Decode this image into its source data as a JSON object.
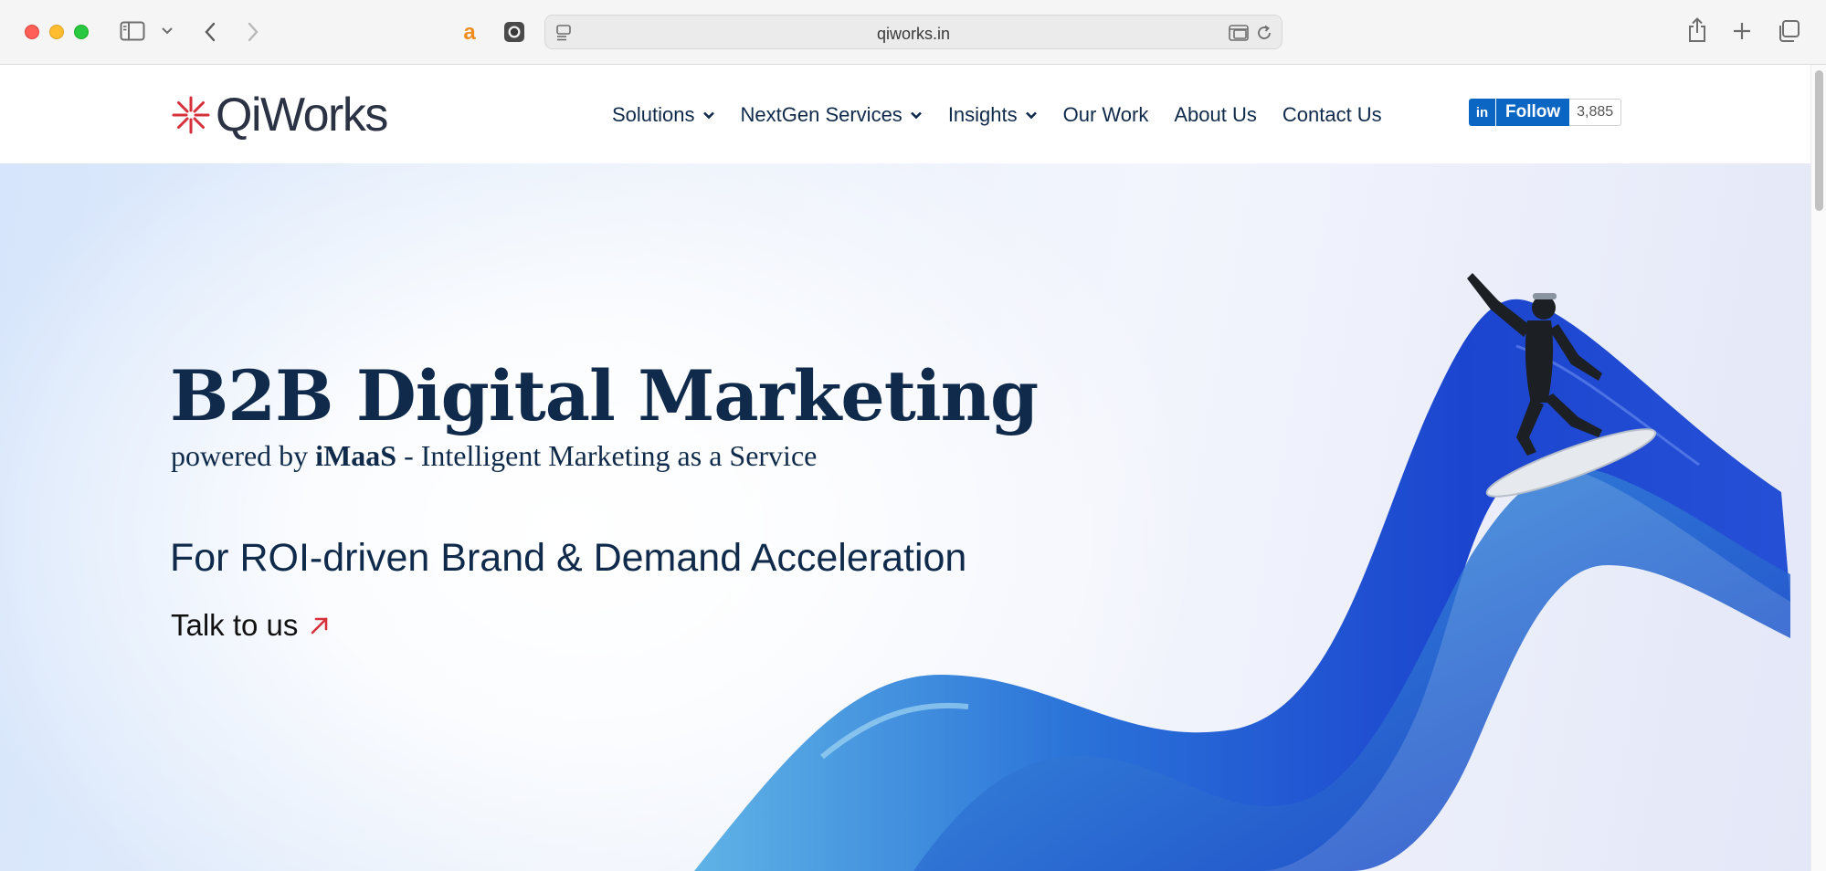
{
  "browser": {
    "url": "qiworks.in"
  },
  "header": {
    "logo_text": "QiWorks",
    "nav": [
      {
        "label": "Solutions",
        "has_dropdown": true
      },
      {
        "label": "NextGen Services",
        "has_dropdown": true
      },
      {
        "label": "Insights",
        "has_dropdown": true
      },
      {
        "label": "Our Work",
        "has_dropdown": false
      },
      {
        "label": "About Us",
        "has_dropdown": false
      },
      {
        "label": "Contact Us",
        "has_dropdown": false
      }
    ],
    "linkedin": {
      "logo": "in",
      "label": "Follow",
      "count": "3,885"
    }
  },
  "hero": {
    "title": "B2B Digital Marketing",
    "subtitle_prefix": "powered by ",
    "subtitle_brand": "iMaaS",
    "subtitle_suffix": " - Intelligent Marketing as a Service",
    "tagline": "For ROI-driven Brand & Demand Acceleration",
    "cta_label": "Talk to us"
  },
  "colors": {
    "brand_navy": "#0f2a4a",
    "logo_red": "#d6303a",
    "linkedin_blue": "#0a66c2",
    "wave_blue": "#1f4fd6"
  },
  "icons": {
    "sidebar": "sidebar-icon",
    "back": "chevron-left-icon",
    "forward": "chevron-right-icon",
    "share": "share-icon",
    "new_tab": "plus-icon",
    "tabs": "tabs-overview-icon",
    "cta_arrow": "arrow-up-right-icon"
  }
}
